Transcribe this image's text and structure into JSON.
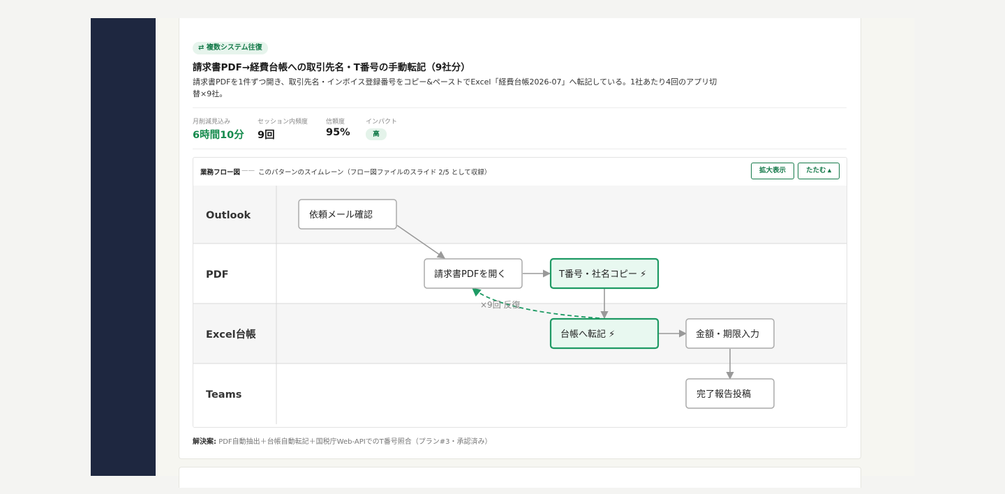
{
  "pattern": {
    "badge_icon": "⇄",
    "badge": "複数システム往復",
    "title": "請求書PDF→経費台帳への取引先名・T番号の手動転記（9社分）",
    "description": "請求書PDFを1件ずつ開き、取引先名・インボイス登録番号をコピー&ペーストでExcel「経費台帳2026-07」へ転記している。1社あたり4回のアプリ切替×9社。"
  },
  "metrics": [
    {
      "label": "月削減見込み",
      "value": "6時間10分",
      "accent": true
    },
    {
      "label": "セッション内頻度",
      "value": "9回"
    },
    {
      "label": "信頼度",
      "value": "95%"
    },
    {
      "label": "インパクト",
      "value": "高"
    }
  ],
  "flow": {
    "title": "業務フロー図",
    "separator": "——",
    "description": "このパターンのスイムレーン（フロー図ファイルのスライド 2/5 として収録）",
    "expand_button": "拡大表示",
    "collapse_button": "たたむ ▴",
    "lanes": [
      "Outlook",
      "PDF",
      "Excel台帳",
      "Teams"
    ],
    "steps": [
      {
        "id": "s1",
        "label": "依頼メール確認",
        "lane": "Outlook",
        "highlight": false
      },
      {
        "id": "s2",
        "label": "請求書PDFを開く",
        "lane": "PDF",
        "highlight": false
      },
      {
        "id": "s3",
        "label": "T番号・社名コピー ⚡",
        "lane": "PDF",
        "highlight": true
      },
      {
        "id": "s4",
        "label": "台帳へ転記 ⚡",
        "lane": "Excel台帳",
        "highlight": true
      },
      {
        "id": "s5",
        "label": "金額・期限入力",
        "lane": "Excel台帳",
        "highlight": false
      },
      {
        "id": "s6",
        "label": "完了報告投稿",
        "lane": "Teams",
        "highlight": false
      }
    ],
    "loop_label": "×9回 反復",
    "colors": {
      "highlight_border": "#1e9a64",
      "highlight_fill": "#e8f8f0",
      "loop_arrow": "#1e9a64",
      "arrow": "#999999"
    }
  },
  "solution": {
    "label": "解決案:",
    "text": "PDF自動抽出＋台帳自動転記＋国税庁Web-APIでのT番号照合（プラン#3・承認済み）"
  }
}
